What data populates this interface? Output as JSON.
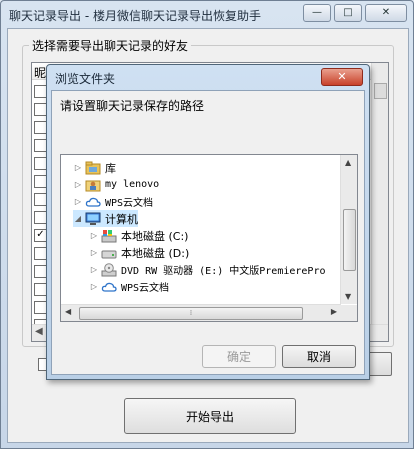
{
  "window": {
    "title": "聊天记录导出 - 楼月微信聊天记录导出恢复助手",
    "min_icon": "minimize-icon",
    "max_icon": "maximize-icon",
    "close_icon": "close-icon"
  },
  "friends_group": {
    "label": "选择需要导出聊天记录的好友",
    "column_header": "昵",
    "rows_checked": [
      false,
      false,
      false,
      false,
      false,
      false,
      false,
      false,
      true,
      false,
      false,
      false,
      false,
      false,
      false,
      false
    ]
  },
  "start_button": {
    "label": "开始导出"
  },
  "dialog": {
    "title": "浏览文件夹",
    "prompt": "请设置聊天记录保存的路径",
    "tree": [
      {
        "label": "库",
        "icon": "library-folder-icon",
        "arrow": "▷",
        "level": 0
      },
      {
        "label": "my lenovo",
        "icon": "user-folder-icon",
        "arrow": "▷",
        "level": 0
      },
      {
        "label": "WPS云文档",
        "icon": "cloud-icon",
        "arrow": "▷",
        "level": 0
      },
      {
        "label": "计算机",
        "icon": "computer-icon",
        "arrow": "◢",
        "level": 0,
        "selected": true
      },
      {
        "label": "本地磁盘 (C:)",
        "icon": "system-drive-icon",
        "arrow": "▷",
        "level": 1
      },
      {
        "label": "本地磁盘 (D:)",
        "icon": "hard-drive-icon",
        "arrow": "▷",
        "level": 1
      },
      {
        "label": "DVD RW 驱动器 (E:) 中文版PremierePro",
        "icon": "dvd-drive-icon",
        "arrow": "▷",
        "level": 1
      },
      {
        "label": "WPS云文档",
        "icon": "cloud-icon",
        "arrow": "▷",
        "level": 1
      }
    ],
    "ok_label": "确定",
    "cancel_label": "取消"
  }
}
